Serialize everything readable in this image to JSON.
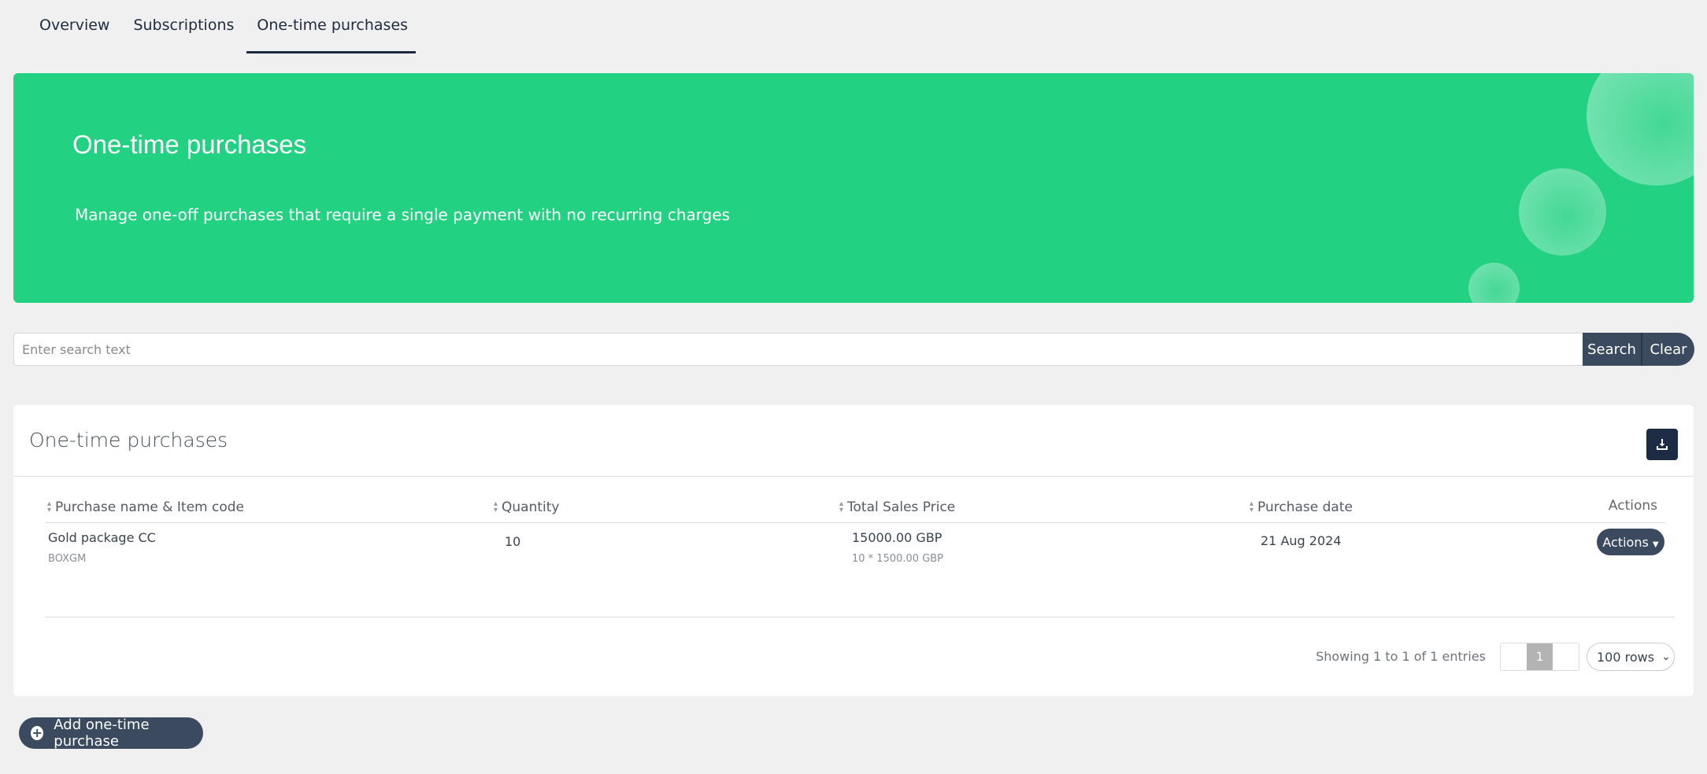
{
  "tabs": [
    {
      "label": "Overview"
    },
    {
      "label": "Subscriptions"
    },
    {
      "label": "One-time purchases"
    }
  ],
  "hero": {
    "title": "One-time purchases",
    "subtitle": "Manage one-off purchases that require a single payment with no recurring charges"
  },
  "search": {
    "placeholder": "Enter search text",
    "search_label": "Search",
    "clear_label": "Clear"
  },
  "card": {
    "title": "One-time purchases",
    "download_icon": "download-icon"
  },
  "table": {
    "columns": [
      "Purchase name & Item code",
      "Quantity",
      "Total Sales Price",
      "Purchase date",
      "Actions"
    ],
    "rows": [
      {
        "name": "Gold package CC",
        "code": "BOXGM",
        "quantity": "10",
        "total": "15000.00 GBP",
        "total_detail": "10 * 1500.00 GBP",
        "date": "21 Aug 2024",
        "actions_label": "Actions"
      }
    ]
  },
  "pagination": {
    "showing": "Showing 1 to 1 of 1 entries",
    "current_page": "1",
    "rows_option": "100 rows"
  },
  "add_button": {
    "label": "Add one-time purchase"
  },
  "colors": {
    "accent_green": "#22d182",
    "dark_button": "#3b4a5e",
    "navy": "#1d2b45"
  }
}
